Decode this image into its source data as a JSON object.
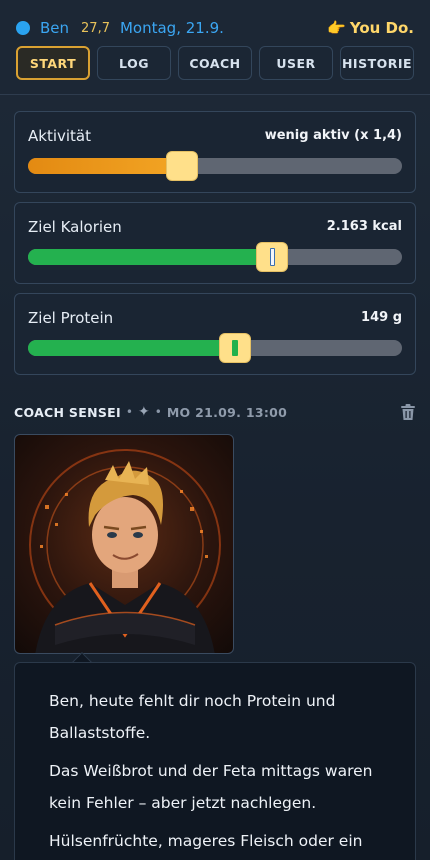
{
  "header": {
    "user_name": "Ben",
    "bmi": "27,7",
    "date": "Montag, 21.9.",
    "slogan": "You Do.",
    "slogan_icon": "pointing-hand-icon"
  },
  "nav": {
    "tabs": [
      {
        "label": "START",
        "active": true
      },
      {
        "label": "LOG",
        "active": false
      },
      {
        "label": "COACH",
        "active": false
      },
      {
        "label": "USER",
        "active": false
      },
      {
        "label": "HISTORIE",
        "active": false
      }
    ]
  },
  "sliders": {
    "activity": {
      "label": "Aktivität",
      "value_text": "wenig aktiv (x 1,4)",
      "level_fraction": 0.41,
      "fill_color": "#f0a020"
    },
    "calories": {
      "label": "Ziel Kalorien",
      "value_text": "2.163 kcal",
      "level_fraction": 0.65,
      "fill_color": "#24b14f"
    },
    "protein": {
      "label": "Ziel Protein",
      "value_text": "149 g",
      "level_fraction": 0.55,
      "fill_color": "#24b14f"
    }
  },
  "coach": {
    "name": "COACH SENSEI",
    "timestamp": "MO 21.09. 13:00",
    "message": [
      "Ben, heute fehlt dir noch Protein und",
      "Ballaststoffe.",
      "Das Weißbrot und der Feta mittags waren",
      "kein Fehler – aber jetzt nachlegen.",
      "Hülsenfrüchte, mageres Fleisch oder ein"
    ]
  },
  "colors": {
    "accent_blue": "#3ba6f2",
    "accent_gold": "#ffd76a",
    "active_tab_border": "#d9a132"
  }
}
